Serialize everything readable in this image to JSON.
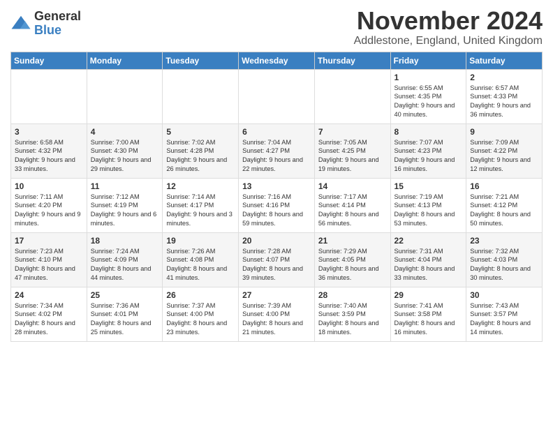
{
  "logo": {
    "general": "General",
    "blue": "Blue"
  },
  "title": {
    "month": "November 2024",
    "location": "Addlestone, England, United Kingdom"
  },
  "headers": [
    "Sunday",
    "Monday",
    "Tuesday",
    "Wednesday",
    "Thursday",
    "Friday",
    "Saturday"
  ],
  "weeks": [
    [
      {
        "day": "",
        "info": ""
      },
      {
        "day": "",
        "info": ""
      },
      {
        "day": "",
        "info": ""
      },
      {
        "day": "",
        "info": ""
      },
      {
        "day": "",
        "info": ""
      },
      {
        "day": "1",
        "info": "Sunrise: 6:55 AM\nSunset: 4:35 PM\nDaylight: 9 hours and 40 minutes."
      },
      {
        "day": "2",
        "info": "Sunrise: 6:57 AM\nSunset: 4:33 PM\nDaylight: 9 hours and 36 minutes."
      }
    ],
    [
      {
        "day": "3",
        "info": "Sunrise: 6:58 AM\nSunset: 4:32 PM\nDaylight: 9 hours and 33 minutes."
      },
      {
        "day": "4",
        "info": "Sunrise: 7:00 AM\nSunset: 4:30 PM\nDaylight: 9 hours and 29 minutes."
      },
      {
        "day": "5",
        "info": "Sunrise: 7:02 AM\nSunset: 4:28 PM\nDaylight: 9 hours and 26 minutes."
      },
      {
        "day": "6",
        "info": "Sunrise: 7:04 AM\nSunset: 4:27 PM\nDaylight: 9 hours and 22 minutes."
      },
      {
        "day": "7",
        "info": "Sunrise: 7:05 AM\nSunset: 4:25 PM\nDaylight: 9 hours and 19 minutes."
      },
      {
        "day": "8",
        "info": "Sunrise: 7:07 AM\nSunset: 4:23 PM\nDaylight: 9 hours and 16 minutes."
      },
      {
        "day": "9",
        "info": "Sunrise: 7:09 AM\nSunset: 4:22 PM\nDaylight: 9 hours and 12 minutes."
      }
    ],
    [
      {
        "day": "10",
        "info": "Sunrise: 7:11 AM\nSunset: 4:20 PM\nDaylight: 9 hours and 9 minutes."
      },
      {
        "day": "11",
        "info": "Sunrise: 7:12 AM\nSunset: 4:19 PM\nDaylight: 9 hours and 6 minutes."
      },
      {
        "day": "12",
        "info": "Sunrise: 7:14 AM\nSunset: 4:17 PM\nDaylight: 9 hours and 3 minutes."
      },
      {
        "day": "13",
        "info": "Sunrise: 7:16 AM\nSunset: 4:16 PM\nDaylight: 8 hours and 59 minutes."
      },
      {
        "day": "14",
        "info": "Sunrise: 7:17 AM\nSunset: 4:14 PM\nDaylight: 8 hours and 56 minutes."
      },
      {
        "day": "15",
        "info": "Sunrise: 7:19 AM\nSunset: 4:13 PM\nDaylight: 8 hours and 53 minutes."
      },
      {
        "day": "16",
        "info": "Sunrise: 7:21 AM\nSunset: 4:12 PM\nDaylight: 8 hours and 50 minutes."
      }
    ],
    [
      {
        "day": "17",
        "info": "Sunrise: 7:23 AM\nSunset: 4:10 PM\nDaylight: 8 hours and 47 minutes."
      },
      {
        "day": "18",
        "info": "Sunrise: 7:24 AM\nSunset: 4:09 PM\nDaylight: 8 hours and 44 minutes."
      },
      {
        "day": "19",
        "info": "Sunrise: 7:26 AM\nSunset: 4:08 PM\nDaylight: 8 hours and 41 minutes."
      },
      {
        "day": "20",
        "info": "Sunrise: 7:28 AM\nSunset: 4:07 PM\nDaylight: 8 hours and 39 minutes."
      },
      {
        "day": "21",
        "info": "Sunrise: 7:29 AM\nSunset: 4:05 PM\nDaylight: 8 hours and 36 minutes."
      },
      {
        "day": "22",
        "info": "Sunrise: 7:31 AM\nSunset: 4:04 PM\nDaylight: 8 hours and 33 minutes."
      },
      {
        "day": "23",
        "info": "Sunrise: 7:32 AM\nSunset: 4:03 PM\nDaylight: 8 hours and 30 minutes."
      }
    ],
    [
      {
        "day": "24",
        "info": "Sunrise: 7:34 AM\nSunset: 4:02 PM\nDaylight: 8 hours and 28 minutes."
      },
      {
        "day": "25",
        "info": "Sunrise: 7:36 AM\nSunset: 4:01 PM\nDaylight: 8 hours and 25 minutes."
      },
      {
        "day": "26",
        "info": "Sunrise: 7:37 AM\nSunset: 4:00 PM\nDaylight: 8 hours and 23 minutes."
      },
      {
        "day": "27",
        "info": "Sunrise: 7:39 AM\nSunset: 4:00 PM\nDaylight: 8 hours and 21 minutes."
      },
      {
        "day": "28",
        "info": "Sunrise: 7:40 AM\nSunset: 3:59 PM\nDaylight: 8 hours and 18 minutes."
      },
      {
        "day": "29",
        "info": "Sunrise: 7:41 AM\nSunset: 3:58 PM\nDaylight: 8 hours and 16 minutes."
      },
      {
        "day": "30",
        "info": "Sunrise: 7:43 AM\nSunset: 3:57 PM\nDaylight: 8 hours and 14 minutes."
      }
    ]
  ]
}
